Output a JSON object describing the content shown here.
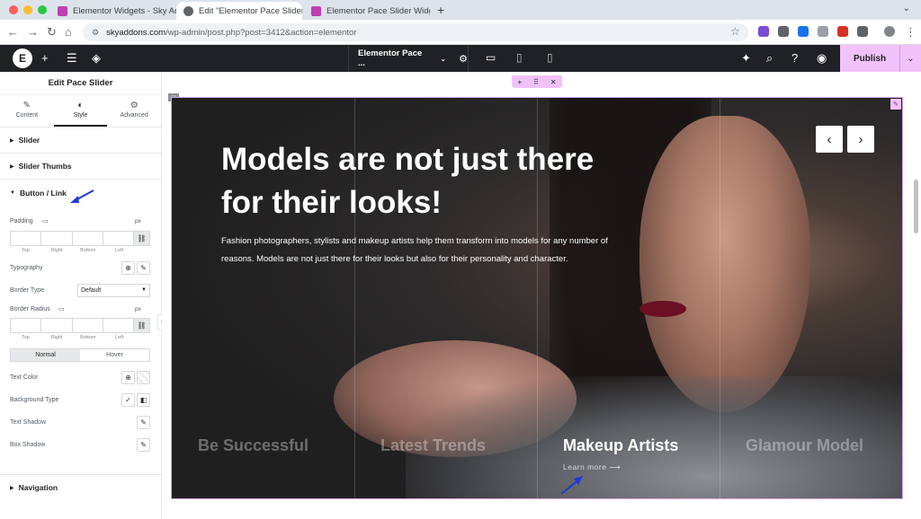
{
  "browser": {
    "tabs": [
      {
        "title": "Elementor Widgets - Sky Addo",
        "active": false
      },
      {
        "title": "Edit \"Elementor Pace Slider W",
        "active": true
      },
      {
        "title": "Elementor Pace Slider Widget",
        "active": false
      }
    ],
    "url_host": "skyaddons.com",
    "url_path": "/wp-admin/post.php?post=3412&action=elementor"
  },
  "editor": {
    "doc_title": "Elementor Pace ...",
    "publish_label": "Publish"
  },
  "panel": {
    "title": "Edit Pace Slider",
    "tabs": [
      {
        "label": "Content",
        "icon": "pencil-icon"
      },
      {
        "label": "Style",
        "icon": "half-circle-icon"
      },
      {
        "label": "Advanced",
        "icon": "gear-icon"
      }
    ],
    "sections": {
      "slider": "Slider",
      "slider_thumbs": "Slider Thumbs",
      "button_link": "Button / Link",
      "navigation": "Navigation"
    },
    "controls": {
      "padding": "Padding",
      "unit": "px",
      "dims": [
        "Top",
        "Right",
        "Bottom",
        "Left"
      ],
      "typography": "Typography",
      "border_type": "Border Type",
      "border_type_value": "Default",
      "border_radius": "Border Radius",
      "normal": "Normal",
      "hover": "Hover",
      "text_color": "Text Color",
      "background_type": "Background Type",
      "text_shadow": "Text Shadow",
      "box_shadow": "Box Shadow"
    }
  },
  "slide": {
    "headline": "Models are not just there for their looks!",
    "description": "Fashion photographers, stylists and makeup artists help them transform into models for any number of reasons. Models are not just there for their looks but also for their personality and character.",
    "thumbs": [
      "Be Successful",
      "Latest Trends",
      "Makeup Artists",
      "Glamour Model"
    ],
    "active_thumb": 2,
    "learn_more": "Learn more ⟶"
  },
  "colors": {
    "accent": "#f0c2f9",
    "toolbar": "#1f2124"
  }
}
